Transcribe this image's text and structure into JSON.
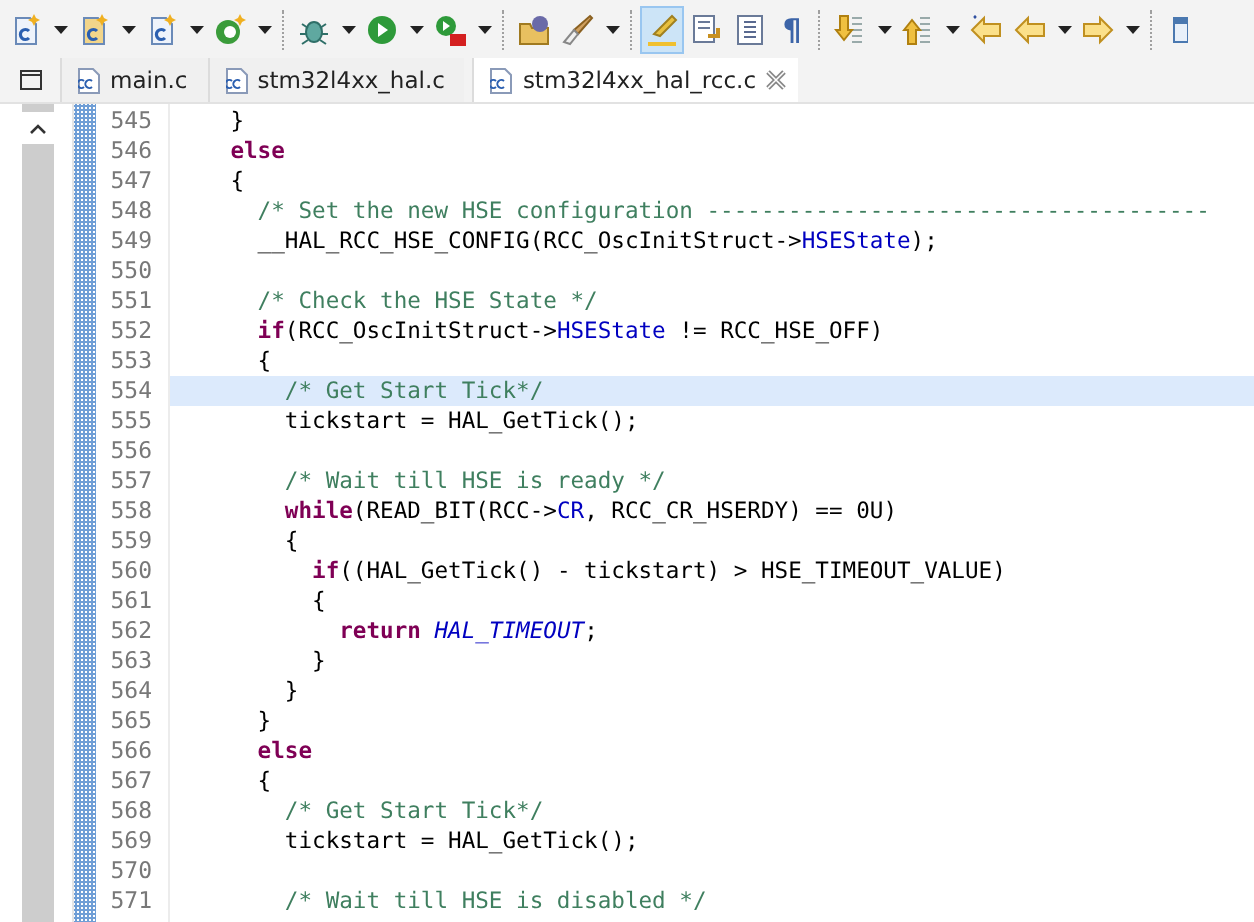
{
  "toolbar": [
    {
      "kind": "button",
      "dropdown": true,
      "pressed": false
    },
    {
      "kind": "button",
      "dropdown": true,
      "pressed": false
    },
    {
      "kind": "button",
      "dropdown": true,
      "pressed": false
    },
    {
      "kind": "button",
      "dropdown": true,
      "pressed": false
    },
    {
      "kind": "separator"
    },
    {
      "kind": "button",
      "dropdown": true,
      "pressed": false
    },
    {
      "kind": "button",
      "dropdown": true,
      "pressed": false
    },
    {
      "kind": "button",
      "dropdown": true,
      "pressed": false
    },
    {
      "kind": "separator"
    },
    {
      "kind": "button",
      "dropdown": false,
      "pressed": false
    },
    {
      "kind": "button",
      "dropdown": true,
      "pressed": false
    },
    {
      "kind": "separator"
    },
    {
      "kind": "button",
      "dropdown": false,
      "pressed": true
    },
    {
      "kind": "button",
      "dropdown": false,
      "pressed": false
    },
    {
      "kind": "button",
      "dropdown": false,
      "pressed": false
    },
    {
      "kind": "glyph",
      "glyph": "¶",
      "dropdown": false,
      "pressed": false
    },
    {
      "kind": "separator"
    },
    {
      "kind": "button",
      "dropdown": true,
      "pressed": false
    },
    {
      "kind": "button",
      "dropdown": true,
      "pressed": false
    },
    {
      "kind": "button",
      "dropdown": false,
      "pressed": false
    },
    {
      "kind": "button",
      "dropdown": true,
      "pressed": false
    },
    {
      "kind": "button",
      "dropdown": true,
      "pressed": false
    },
    {
      "kind": "separator"
    },
    {
      "kind": "button",
      "dropdown": false,
      "pressed": false
    }
  ],
  "tabs": [
    {
      "label": "main.c",
      "selected": false,
      "closable": false
    },
    {
      "label": "stm32l4xx_hal.c",
      "selected": false,
      "closable": false
    },
    {
      "label": "stm32l4xx_hal_rcc.c",
      "selected": true,
      "closable": true
    }
  ],
  "editor": {
    "lines": [
      {
        "number": "545",
        "highlighted": false,
        "tokens": [
          {
            "kind": "plain",
            "text": "    }"
          }
        ]
      },
      {
        "number": "546",
        "highlighted": false,
        "tokens": [
          {
            "kind": "keyword",
            "text": "    else"
          }
        ]
      },
      {
        "number": "547",
        "highlighted": false,
        "tokens": [
          {
            "kind": "plain",
            "text": "    {"
          }
        ]
      },
      {
        "number": "548",
        "highlighted": false,
        "tokens": [
          {
            "kind": "comment",
            "text": "      /* Set the new HSE configuration -------------------------------------"
          }
        ]
      },
      {
        "number": "549",
        "highlighted": false,
        "tokens": [
          {
            "kind": "plain",
            "text": "      __HAL_RCC_HSE_CONFIG(RCC_OscInitStruct->"
          },
          {
            "kind": "field",
            "text": "HSEState"
          },
          {
            "kind": "plain",
            "text": ");"
          }
        ]
      },
      {
        "number": "550",
        "highlighted": false
      },
      {
        "number": "551",
        "highlighted": false,
        "tokens": [
          {
            "kind": "comment",
            "text": "      /* Check the HSE State */"
          }
        ]
      },
      {
        "number": "552",
        "highlighted": false,
        "tokens": [
          {
            "kind": "keyword",
            "text": "      if"
          },
          {
            "kind": "plain",
            "text": "(RCC_OscInitStruct->"
          },
          {
            "kind": "field",
            "text": "HSEState"
          },
          {
            "kind": "plain",
            "text": " != RCC_HSE_OFF)"
          }
        ]
      },
      {
        "number": "553",
        "highlighted": false,
        "tokens": [
          {
            "kind": "plain",
            "text": "      {"
          }
        ]
      },
      {
        "number": "554",
        "highlighted": true,
        "tokens": [
          {
            "kind": "comment",
            "text": "        /* Get Start Tick*/"
          }
        ]
      },
      {
        "number": "555",
        "highlighted": false,
        "tokens": [
          {
            "kind": "plain",
            "text": "        tickstart = HAL_GetTick();"
          }
        ]
      },
      {
        "number": "556",
        "highlighted": false
      },
      {
        "number": "557",
        "highlighted": false,
        "tokens": [
          {
            "kind": "comment",
            "text": "        /* Wait till HSE is ready */"
          }
        ]
      },
      {
        "number": "558",
        "highlighted": false,
        "tokens": [
          {
            "kind": "keyword",
            "text": "        while"
          },
          {
            "kind": "plain",
            "text": "(READ_BIT(RCC->"
          },
          {
            "kind": "field",
            "text": "CR"
          },
          {
            "kind": "plain",
            "text": ", RCC_CR_HSERDY) == 0U)"
          }
        ]
      },
      {
        "number": "559",
        "highlighted": false,
        "tokens": [
          {
            "kind": "plain",
            "text": "        {"
          }
        ]
      },
      {
        "number": "560",
        "highlighted": false,
        "tokens": [
          {
            "kind": "keyword",
            "text": "          if"
          },
          {
            "kind": "plain",
            "text": "((HAL_GetTick() - tickstart) > HSE_TIMEOUT_VALUE)"
          }
        ]
      },
      {
        "number": "561",
        "highlighted": false,
        "tokens": [
          {
            "kind": "plain",
            "text": "          {"
          }
        ]
      },
      {
        "number": "562",
        "highlighted": false,
        "tokens": [
          {
            "kind": "keyword",
            "text": "            return "
          },
          {
            "kind": "enum",
            "text": "HAL_TIMEOUT"
          },
          {
            "kind": "plain",
            "text": ";"
          }
        ]
      },
      {
        "number": "563",
        "highlighted": false,
        "tokens": [
          {
            "kind": "plain",
            "text": "          }"
          }
        ]
      },
      {
        "number": "564",
        "highlighted": false,
        "tokens": [
          {
            "kind": "plain",
            "text": "        }"
          }
        ]
      },
      {
        "number": "565",
        "highlighted": false,
        "tokens": [
          {
            "kind": "plain",
            "text": "      }"
          }
        ]
      },
      {
        "number": "566",
        "highlighted": false,
        "tokens": [
          {
            "kind": "keyword",
            "text": "      else"
          }
        ]
      },
      {
        "number": "567",
        "highlighted": false,
        "tokens": [
          {
            "kind": "plain",
            "text": "      {"
          }
        ]
      },
      {
        "number": "568",
        "highlighted": false,
        "tokens": [
          {
            "kind": "comment",
            "text": "        /* Get Start Tick*/"
          }
        ]
      },
      {
        "number": "569",
        "highlighted": false,
        "tokens": [
          {
            "kind": "plain",
            "text": "        tickstart = HAL_GetTick();"
          }
        ]
      },
      {
        "number": "570",
        "highlighted": false
      },
      {
        "number": "571",
        "highlighted": false,
        "tokens": [
          {
            "kind": "comment",
            "text": "        /* Wait till HSE is disabled */"
          }
        ]
      }
    ]
  }
}
